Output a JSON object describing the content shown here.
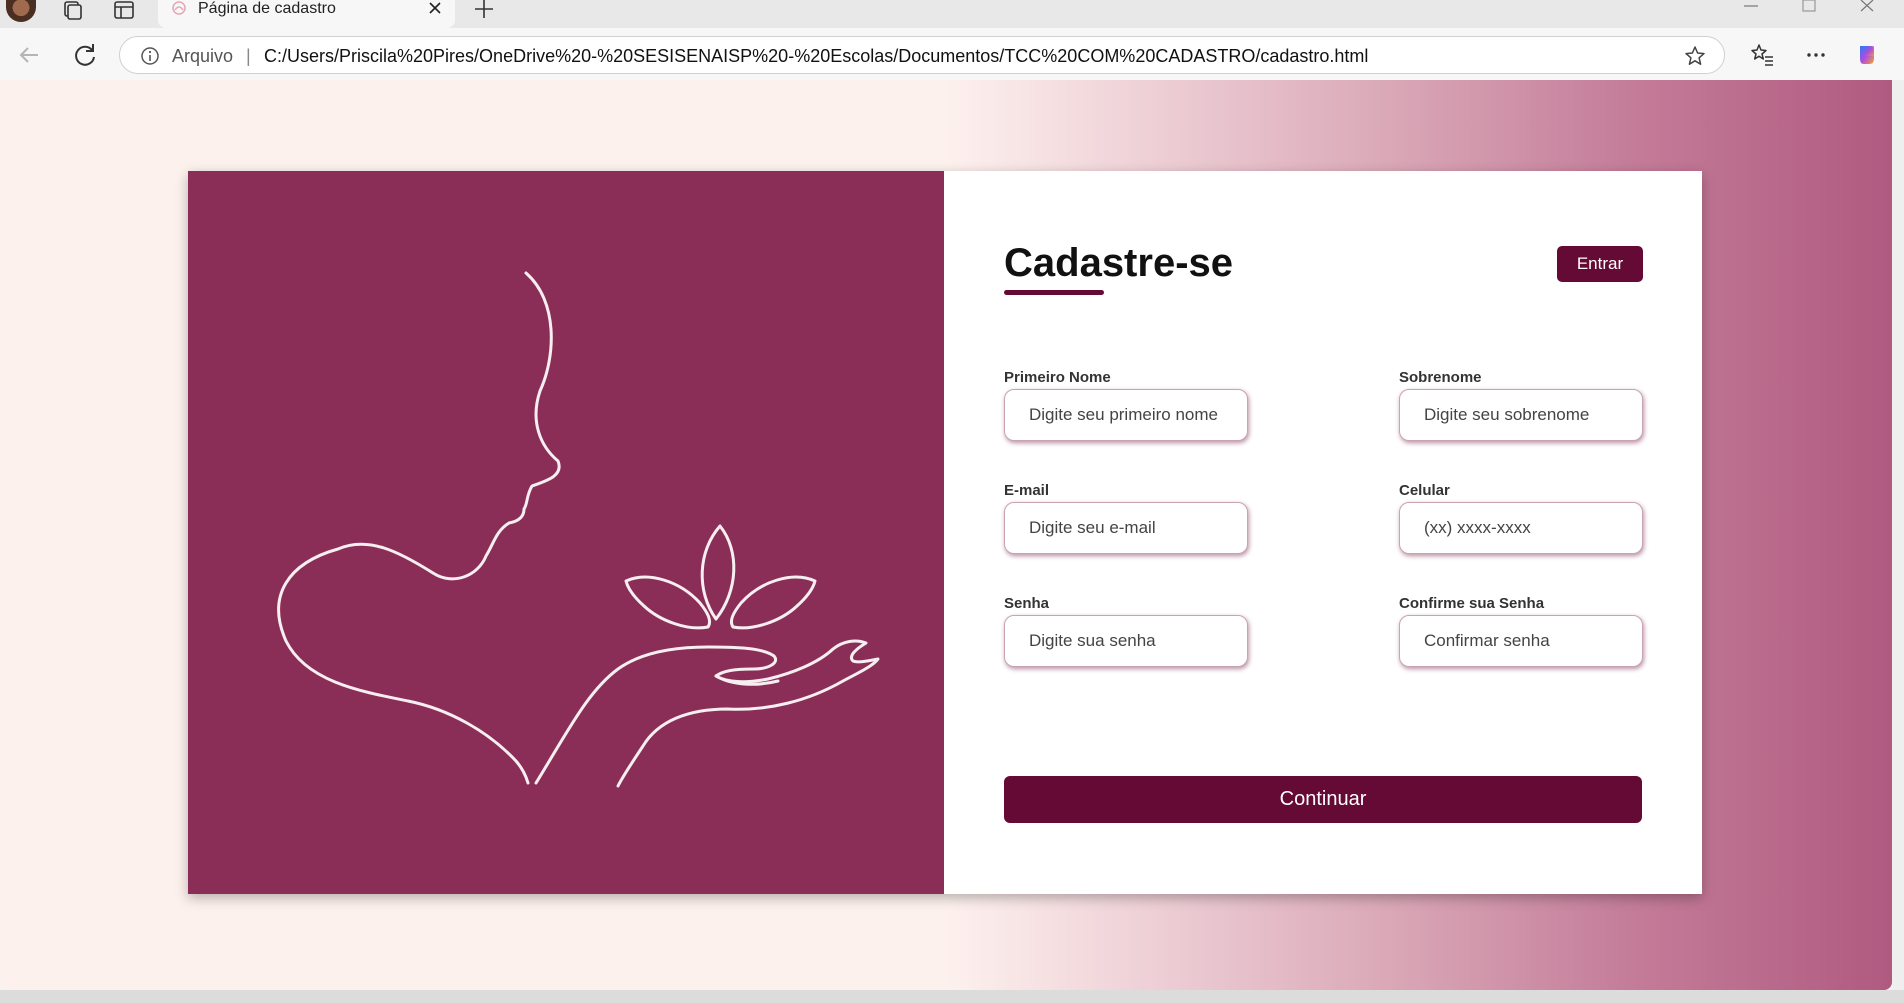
{
  "browser": {
    "tab_title": "Página de cadastro",
    "address_label": "Arquivo",
    "address_separator": "|",
    "url": "C:/Users/Priscila%20Pires/OneDrive%20-%20SESISENAISP%20-%20Escolas/Documentos/TCC%20COM%20CADASTRO/cadastro.html"
  },
  "page": {
    "title": "Cadastre-se",
    "login_button": "Entrar",
    "submit_button": "Continuar",
    "fields": {
      "first_name": {
        "label": "Primeiro Nome",
        "placeholder": "Digite seu primeiro nome"
      },
      "last_name": {
        "label": "Sobrenome",
        "placeholder": "Digite seu sobrenome"
      },
      "email": {
        "label": "E-mail",
        "placeholder": "Digite seu e-mail"
      },
      "phone": {
        "label": "Celular",
        "placeholder": "(xx) xxxx-xxxx"
      },
      "password": {
        "label": "Senha",
        "placeholder": "Digite sua senha"
      },
      "confirm_password": {
        "label": "Confirme sua Senha",
        "placeholder": "Confirmar senha"
      }
    }
  },
  "colors": {
    "accent": "#650a34",
    "panel": "#8a2e58",
    "background_light": "#fdf1ee",
    "background_dark": "#b05a80"
  },
  "icons": {
    "illustration": "woman-face-hand-lotus-line-art"
  }
}
